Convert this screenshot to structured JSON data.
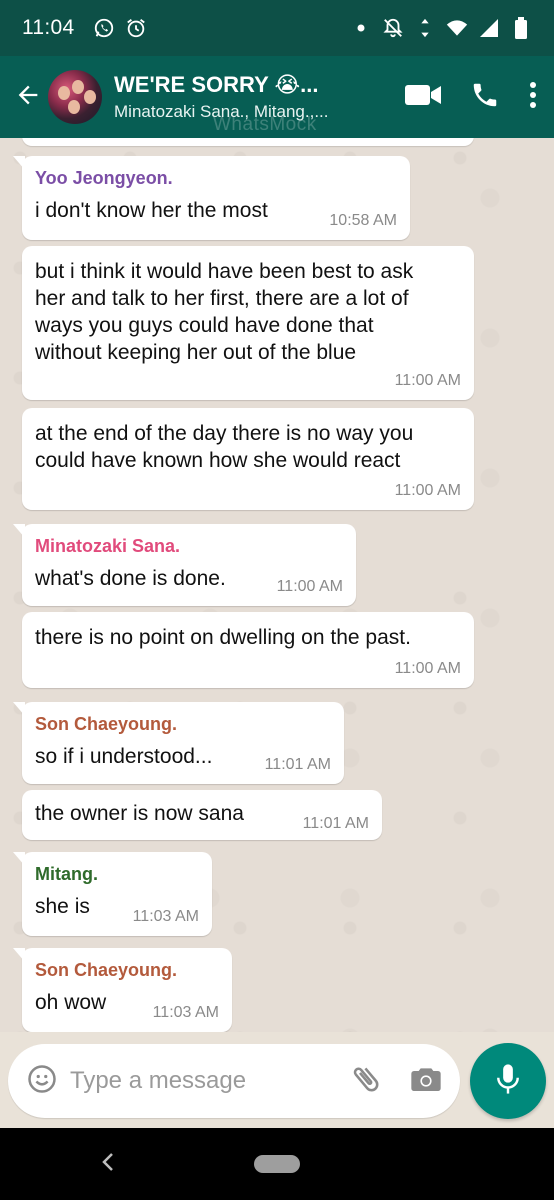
{
  "status_bar": {
    "time": "11:04",
    "icons": [
      "whatsapp-icon",
      "alarm-icon",
      "dot-icon",
      "notifications-off-icon",
      "wifi-icon",
      "signal-icon",
      "battery-icon"
    ]
  },
  "header": {
    "title": "WE'RE SORRY 😭...",
    "subtitle": "Minatozaki Sana., Mitang.,...",
    "watermark": "WhatsMock",
    "icons": [
      "back-arrow-icon",
      "video-call-icon",
      "phone-icon",
      "more-vert-icon"
    ]
  },
  "messages": [
    {
      "sender": "Yoo Jeongyeon.",
      "sender_color": "#7b4ea6",
      "text": "i don't know her the most",
      "time": "10:58 AM"
    },
    {
      "sender": "",
      "text": "but i think it would have been best to ask her and talk to her first, there are a lot of ways you guys could have done that without keeping her out of the blue",
      "time": "11:00 AM"
    },
    {
      "sender": "",
      "text": "at the end of the day there is no way you could have known how she would react",
      "time": "11:00 AM"
    },
    {
      "sender": "Minatozaki Sana.",
      "sender_color": "#e14b7c",
      "text": "what's done is done.",
      "time": "11:00 AM"
    },
    {
      "sender": "",
      "text": "there is no point on dwelling on the past.",
      "time": "11:00 AM"
    },
    {
      "sender": "Son Chaeyoung.",
      "sender_color": "#b35a3c",
      "text": "so if i understood...",
      "time": "11:01 AM"
    },
    {
      "sender": "",
      "text": "the owner is now sana",
      "time": "11:01 AM"
    },
    {
      "sender": "Mitang.",
      "sender_color": "#2f6b2b",
      "text": "she is",
      "time": "11:03 AM"
    },
    {
      "sender": "Son Chaeyoung.",
      "sender_color": "#b35a3c",
      "text": "oh wow",
      "time": "11:03 AM"
    }
  ],
  "composer": {
    "placeholder": "Type a message",
    "icons": [
      "emoji-icon",
      "attach-icon",
      "camera-icon",
      "mic-icon"
    ]
  },
  "colors": {
    "status_bar": "#0d5047",
    "app_bar": "#075e54",
    "mic_button": "#00897b",
    "chat_background": "#e5ddd5"
  }
}
